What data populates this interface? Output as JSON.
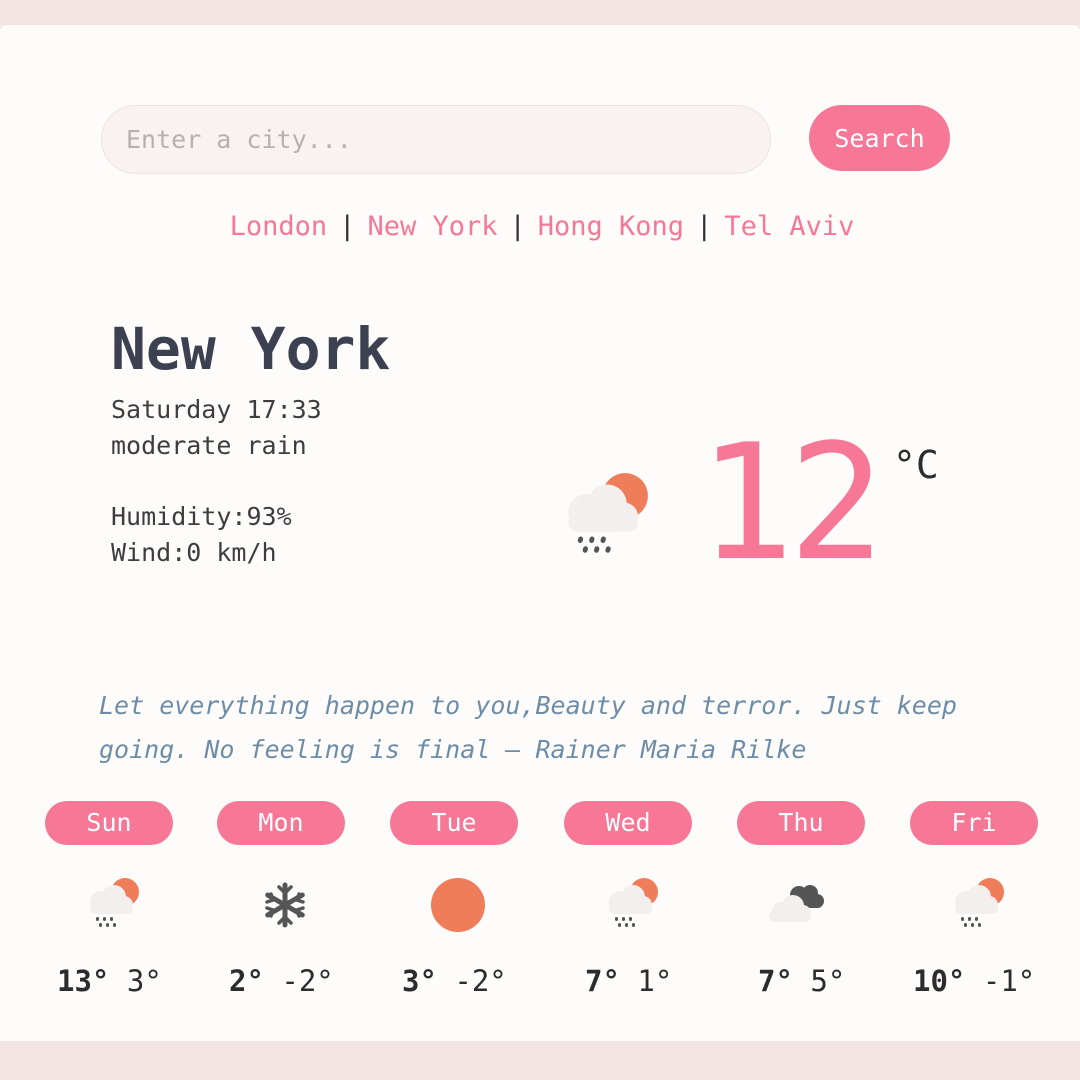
{
  "search": {
    "placeholder": "Enter a city...",
    "button_label": "Search"
  },
  "quick_cities": [
    "London",
    "New York",
    "Hong Kong",
    "Tel Aviv"
  ],
  "current": {
    "city": "New York",
    "datetime": "Saturday 17:33",
    "description": "moderate rain",
    "humidity_label": "Humidity:93%",
    "wind_label": "Wind:0 km/h",
    "icon": "rain-sun-icon",
    "temperature": "12",
    "unit": "°C"
  },
  "quote": "Let everything happen to you,Beauty and terror. Just keep going. No feeling is final — Rainer Maria Rilke",
  "forecast": [
    {
      "day": "Sun",
      "icon": "rain-sun-icon",
      "max": "13°",
      "min": "3°"
    },
    {
      "day": "Mon",
      "icon": "snowflake-icon",
      "max": "2°",
      "min": "-2°"
    },
    {
      "day": "Tue",
      "icon": "sun-icon",
      "max": "3°",
      "min": "-2°"
    },
    {
      "day": "Wed",
      "icon": "rain-sun-icon",
      "max": "7°",
      "min": "1°"
    },
    {
      "day": "Thu",
      "icon": "cloudy-icon",
      "max": "7°",
      "min": "5°"
    },
    {
      "day": "Fri",
      "icon": "rain-sun-icon",
      "max": "10°",
      "min": "-1°"
    }
  ],
  "colors": {
    "accent": "#f67896",
    "sun": "#ef7d59",
    "quote": "#6d8da6",
    "heading": "#3b4150"
  }
}
